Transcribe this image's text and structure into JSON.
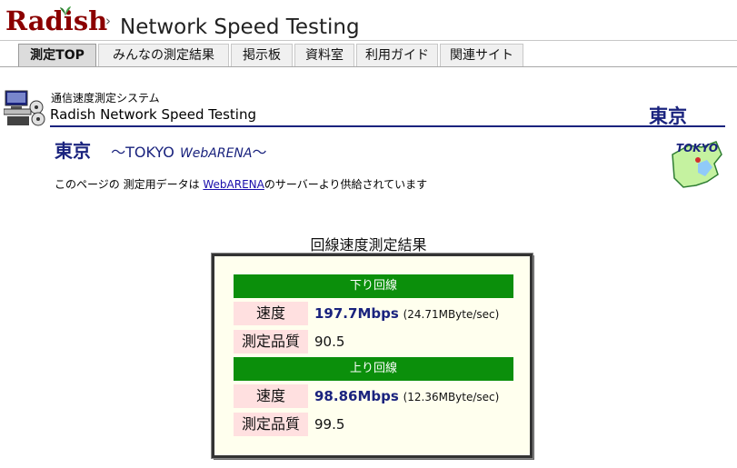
{
  "header": {
    "logo": "Radish",
    "title": "Network Speed Testing"
  },
  "tabs": [
    {
      "label": "測定TOP",
      "active": true
    },
    {
      "label": "みんなの測定結果",
      "active": false
    },
    {
      "label": "掲示板",
      "active": false
    },
    {
      "label": "資料室",
      "active": false
    },
    {
      "label": "利用ガイド",
      "active": false
    },
    {
      "label": "関連サイト",
      "active": false
    }
  ],
  "system": {
    "label": "通信速度測定システム",
    "title": "Radish Network Speed Testing",
    "city": "東京"
  },
  "location": {
    "city": "東京",
    "prefix": "〜TOKYO",
    "arena": "WebARENA",
    "suffix": "〜",
    "badge": "TOKYO"
  },
  "note": {
    "before": "このページの 測定用データは ",
    "link": "WebARENA",
    "after": "のサーバーより供給されています"
  },
  "result": {
    "title": "回線速度測定結果",
    "download": {
      "header": "下り回線",
      "speed_label": "速度",
      "speed_value": "197.7Mbps",
      "speed_detail": "(24.71MByte/sec)",
      "quality_label": "測定品質",
      "quality_value": "90.5"
    },
    "upload": {
      "header": "上り回線",
      "speed_label": "速度",
      "speed_value": "98.86Mbps",
      "speed_detail": "(12.36MByte/sec)",
      "quality_label": "測定品質",
      "quality_value": "99.5"
    }
  },
  "colors": {
    "brand": "#8b0000",
    "navy": "#1a237e",
    "bar_green": "#0b8f0b",
    "label_pink": "#ffe0e0",
    "box_bg": "#ffffee"
  }
}
